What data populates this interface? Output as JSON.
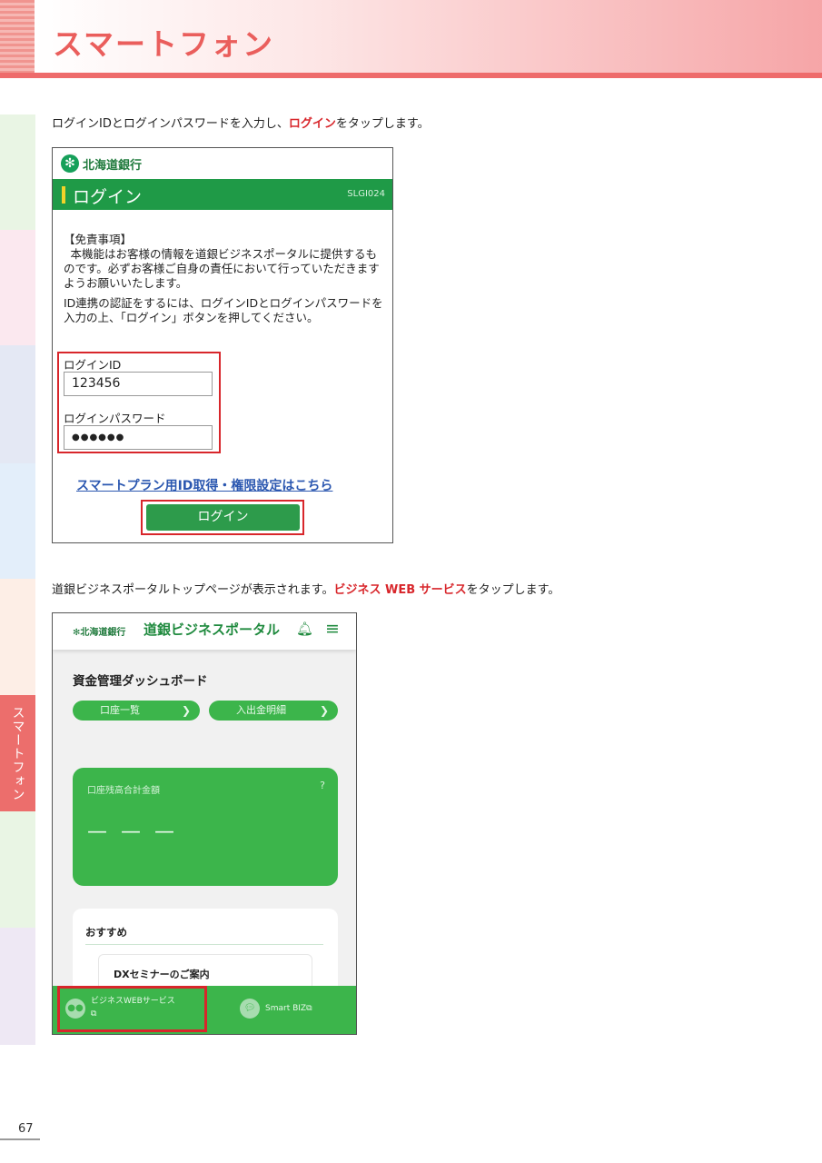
{
  "page": {
    "title": "スマートフォン",
    "side_tab_active": "スマートフォン",
    "page_number": "67"
  },
  "step1": {
    "instruction_pre": "ログインIDとログインパスワードを入力し、",
    "instruction_em": "ログイン",
    "instruction_post": "をタップします。"
  },
  "login_screen": {
    "bank_logo": "北海道銀行",
    "title": "ログイン",
    "screen_code": "SLGI024",
    "disclaimer_heading": "【免責事項】",
    "disclaimer_body": "本機能はお客様の情報を道銀ビジネスポータルに提供するものです。必ずお客様ご自身の責任において行っていただきますようお願いいたします。",
    "instruction": "ID連携の認証をするには、ログインIDとログインパスワードを入力の上、「ログイン」ボタンを押してください。",
    "id_label": "ログインID",
    "id_value": "123456",
    "password_label": "ログインパスワード",
    "password_value": "●●●●●●",
    "link_text": "スマートプラン用ID取得・権限設定はこちら",
    "login_button": "ログイン"
  },
  "step2": {
    "instruction_pre": "道銀ビジネスポータルトップページが表示されます。",
    "instruction_em": "ビジネス WEB サービス",
    "instruction_post": "をタップします。"
  },
  "portal_screen": {
    "bank_logo": "北海道銀行",
    "portal_title": "道銀ビジネスポータル",
    "dashboard_title": "資金管理ダッシュボード",
    "account_list_button": "口座一覧",
    "transactions_button": "入出金明細",
    "balance_label": "口座残高合計金額",
    "balance_value": "— — —",
    "recommend_title": "おすすめ",
    "recommend_item": "DXセミナーのご案内",
    "nav_business_web": "ビジネスWEBサービス",
    "nav_smart_biz": "Smart BIZ"
  },
  "colors": {
    "accent_red": "#d8262b",
    "header_red": "#ea5e5c",
    "bank_green": "#1f9a47",
    "portal_green": "#3cb54b"
  },
  "icons": {
    "bell": "bell-icon",
    "menu": "hamburger-menu-icon",
    "external": "external-link-icon"
  }
}
